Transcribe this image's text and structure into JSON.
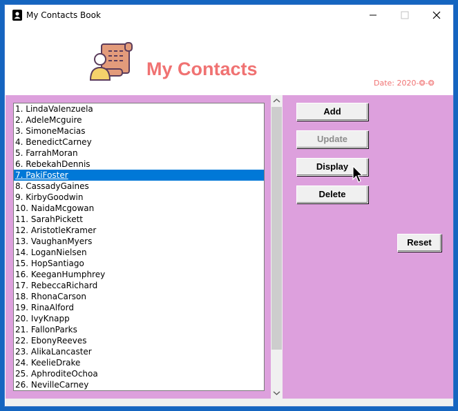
{
  "window": {
    "title": "My Contacts Book"
  },
  "header": {
    "title": "My Contacts",
    "date_label": "Date: 2020-❂-❂"
  },
  "contacts": [
    "1. LindaValenzuela",
    "2. AdeleMcguire",
    "3. SimoneMacias",
    "4. BenedictCarney",
    "5. FarrahMoran",
    "6. RebekahDennis",
    "7. PakiFoster",
    "8. CassadyGaines",
    "9. KirbyGoodwin",
    "10. NaidaMcgowan",
    "11. SarahPickett",
    "12. AristotleKramer",
    "13. VaughanMyers",
    "14. LoganNielsen",
    "15. HopSantiago",
    "16. KeeganHumphrey",
    "17. RebeccaRichard",
    "18. RhonaCarson",
    "19. RinaAlford",
    "20. IvyKnapp",
    "21. FallonParks",
    "22. EbonyReeves",
    "23. AlikaLancaster",
    "24. KeelieDrake",
    "25. AphroditeOchoa",
    "26. NevilleCarney"
  ],
  "selected_index": 6,
  "buttons": {
    "add": "Add",
    "update": "Update",
    "display": "Display",
    "delete": "Delete",
    "reset": "Reset"
  },
  "colors": {
    "accent": "#f07272",
    "panel": "#dda0dd",
    "selection": "#0078d7"
  }
}
